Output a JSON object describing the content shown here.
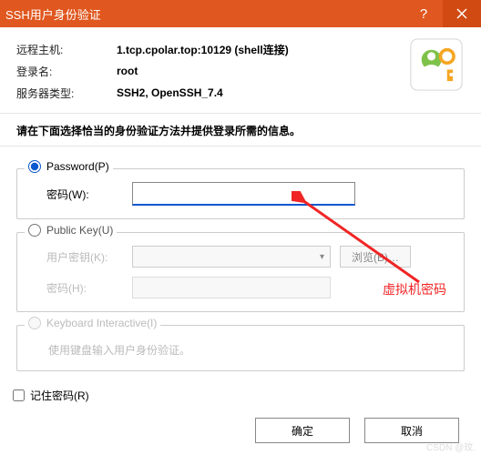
{
  "title": "SSH用户身份验证",
  "info": {
    "host_label": "远程主机:",
    "host_value": "1.tcp.cpolar.top:10129 (shell连接)",
    "login_label": "登录名:",
    "login_value": "root",
    "server_label": "服务器类型:",
    "server_value": "SSH2, OpenSSH_7.4"
  },
  "instruction": "请在下面选择恰当的身份验证方法并提供登录所需的信息。",
  "methods": {
    "password_label": "Password(P)",
    "password_field": "密码(W):",
    "publickey_label": "Public Key(U)",
    "userkey_label": "用户密钥(K):",
    "browse_label": "浏览(B)…",
    "pk_password_label": "密码(H):",
    "ki_label": "Keyboard Interactive(I)",
    "ki_note": "使用键盘输入用户身份验证。"
  },
  "remember_label": "记住密码(R)",
  "buttons": {
    "ok": "确定",
    "cancel": "取消"
  },
  "annotation": "虚拟机密码",
  "watermark": "CSDN @玟."
}
